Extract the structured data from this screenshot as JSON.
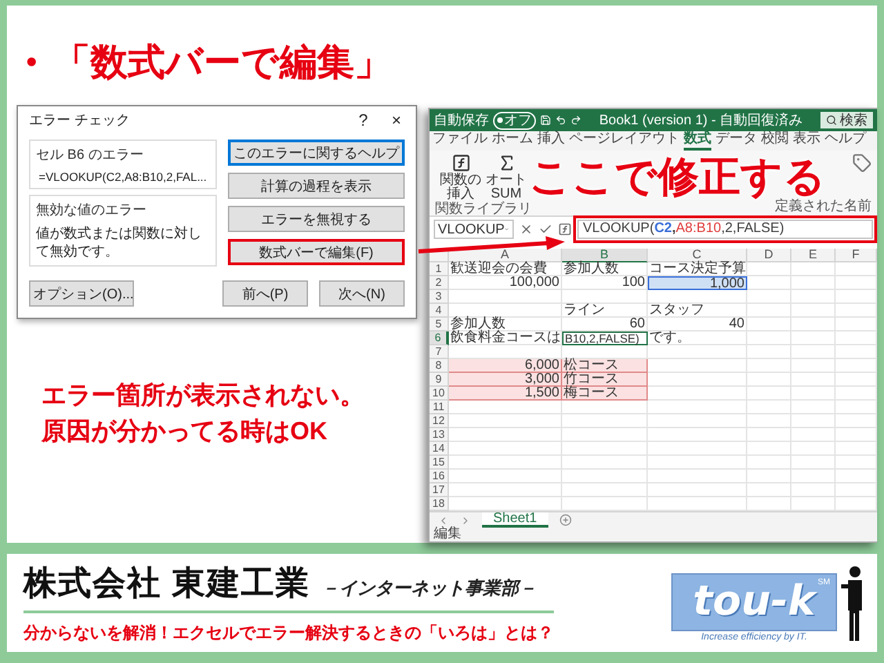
{
  "slide_title": {
    "bullet": "•",
    "text": "「数式バーで編集」"
  },
  "dialog": {
    "title": "エラー チェック",
    "help": "?",
    "close": "×",
    "error_group": {
      "label": "セル B6 のエラー",
      "formula": "=VLOOKUP(C2,A8:B10,2,FAL..."
    },
    "type_group": {
      "label": "無効な値のエラー",
      "message": "値が数式または関数に対して無効です。"
    },
    "buttons": [
      {
        "label": "このエラーに関するヘルプ",
        "focused": true,
        "highlighted": false
      },
      {
        "label": "計算の過程を表示",
        "focused": false,
        "highlighted": false
      },
      {
        "label": "エラーを無視する",
        "focused": false,
        "highlighted": false
      },
      {
        "label": "数式バーで編集(F)",
        "focused": false,
        "highlighted": true
      }
    ],
    "footer_buttons": [
      "オプション(O)...",
      "前へ(P)",
      "次へ(N)"
    ]
  },
  "note": [
    "エラー箇所が表示されない。",
    "原因が分かってる時はOK"
  ],
  "excel": {
    "title_bar": {
      "autosave": "自動保存",
      "toggle": "オフ",
      "title": "Book1 (version 1) - 自動回復済み",
      "search": "検索"
    },
    "tabs": [
      {
        "label": "ファイル",
        "selected": false
      },
      {
        "label": "ホーム",
        "selected": false
      },
      {
        "label": "挿入",
        "selected": false
      },
      {
        "label": "ページレイアウト",
        "selected": false
      },
      {
        "label": "数式",
        "selected": true
      },
      {
        "label": "データ",
        "selected": false
      },
      {
        "label": "校閲",
        "selected": false
      },
      {
        "label": "表示",
        "selected": false
      },
      {
        "label": "ヘルプ",
        "selected": false
      }
    ],
    "ribbon": {
      "buttons": [
        "関数の挿入",
        "オート SUM"
      ],
      "groups": [
        "関数ライブラリ",
        "定義された名前"
      ]
    },
    "overlay": "ここで修正する",
    "name_box": "VLOOKUP",
    "formula": [
      {
        "text": "VLOOKUP(",
        "color": "#404040"
      },
      {
        "text": "C2",
        "color": "#3a6fd8"
      },
      {
        "text": ",",
        "color": "#404040"
      },
      {
        "text": "A8:B10",
        "color": "#e03c3c"
      },
      {
        "text": ",2,FALSE)",
        "color": "#404040"
      }
    ],
    "formula_highlighted": true,
    "columns": [
      {
        "label": "A",
        "selected": false
      },
      {
        "label": "B",
        "selected": true
      },
      {
        "label": "C",
        "selected": false
      },
      {
        "label": "D",
        "selected": false
      },
      {
        "label": "E",
        "selected": false
      },
      {
        "label": "F",
        "selected": false
      }
    ],
    "rows": [
      {
        "number": "1",
        "selected": false,
        "cells": [
          {
            "text": "歓送迎会の会費",
            "kind": "text",
            "selected": false,
            "editing": false,
            "referenced": false
          },
          {
            "text": "参加人数",
            "kind": "text",
            "selected": false,
            "editing": false,
            "referenced": false
          },
          {
            "text": "コース決定予算",
            "kind": "text",
            "selected": false,
            "editing": false,
            "referenced": false
          }
        ]
      },
      {
        "number": "2",
        "selected": false,
        "cells": [
          {
            "text": "100,000",
            "kind": "number",
            "selected": false,
            "editing": false,
            "referenced": false
          },
          {
            "text": "100",
            "kind": "number",
            "selected": false,
            "editing": false,
            "referenced": false
          },
          {
            "text": "1,000",
            "kind": "number",
            "selected": true,
            "editing": false,
            "referenced": false
          }
        ]
      },
      {
        "number": "3",
        "selected": false
      },
      {
        "number": "4",
        "selected": false,
        "cells": [
          {
            "kind": "empty"
          },
          {
            "text": "ライン",
            "kind": "text",
            "selected": false,
            "editing": false,
            "referenced": false
          },
          {
            "text": "スタッフ",
            "kind": "text",
            "selected": false,
            "editing": false,
            "referenced": false
          }
        ]
      },
      {
        "number": "5",
        "selected": false,
        "cells": [
          {
            "text": "参加人数",
            "kind": "text",
            "selected": false,
            "editing": false,
            "referenced": false
          },
          {
            "text": "60",
            "kind": "number",
            "selected": false,
            "editing": false,
            "referenced": false
          },
          {
            "text": "40",
            "kind": "number",
            "selected": false,
            "editing": false,
            "referenced": false
          }
        ]
      },
      {
        "number": "6",
        "selected": true,
        "cells": [
          {
            "text": "飲食料金コースは",
            "kind": "text",
            "selected": false,
            "editing": false,
            "referenced": false
          },
          {
            "text": "B10,2,FALSE)",
            "kind": "text",
            "selected": false,
            "editing": true,
            "referenced": false
          },
          {
            "text": "です。",
            "kind": "text",
            "selected": false,
            "editing": false,
            "referenced": false
          }
        ]
      },
      {
        "number": "7",
        "selected": false
      },
      {
        "number": "8",
        "selected": false,
        "cells": [
          {
            "text": "6,000",
            "kind": "number",
            "selected": false,
            "editing": false,
            "referenced": true
          },
          {
            "text": "松コース",
            "kind": "text",
            "selected": false,
            "editing": false,
            "referenced": true
          }
        ]
      },
      {
        "number": "9",
        "selected": false,
        "cells": [
          {
            "text": "3,000",
            "kind": "number",
            "selected": false,
            "editing": false,
            "referenced": true
          },
          {
            "text": "竹コース",
            "kind": "text",
            "selected": false,
            "editing": false,
            "referenced": true
          }
        ]
      },
      {
        "number": "10",
        "selected": false,
        "cells": [
          {
            "text": "1,500",
            "kind": "number",
            "selected": false,
            "editing": false,
            "referenced": true
          },
          {
            "text": "梅コース",
            "kind": "text",
            "selected": false,
            "editing": false,
            "referenced": true
          }
        ]
      },
      {
        "number": "11",
        "selected": false
      },
      {
        "number": "12",
        "selected": false
      },
      {
        "number": "13",
        "selected": false
      },
      {
        "number": "14",
        "selected": false
      },
      {
        "number": "15",
        "selected": false
      },
      {
        "number": "16",
        "selected": false
      },
      {
        "number": "17",
        "selected": false
      },
      {
        "number": "18",
        "selected": false
      }
    ],
    "sheets": [
      {
        "label": "Sheet1",
        "selected": true
      }
    ],
    "status": "編集"
  },
  "footer": {
    "company": "株式会社 東建工業",
    "division": "－インターネット事業部－",
    "tagline": "分からないを解消！エクセルでエラー解決するときの「いろは」とは？",
    "logo": {
      "text": "tou-k",
      "mark": "SM",
      "slogan": "Increase efficiency by IT."
    }
  }
}
